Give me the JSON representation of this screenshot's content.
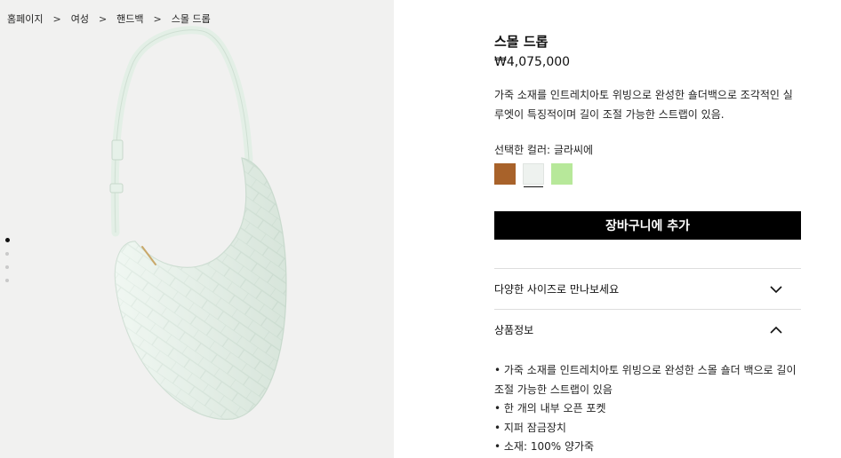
{
  "breadcrumb": {
    "items": [
      "홈페이지",
      "여성",
      "핸드백",
      "스몰 드롭"
    ],
    "separator": ">"
  },
  "gallery": {
    "image_icon": "bag-product-image",
    "dots_count": 4,
    "active_dot": 0
  },
  "product": {
    "title": "스몰 드롭",
    "price": "₩4,075,000",
    "description": "가죽 소재를 인트레치아토 위빙으로 완성한 숄더백으로 조각적인 실루엣이 특징적이며 길이 조절 가능한 스트랩이 있음."
  },
  "color": {
    "label": "선택한 컬러: 글라씨에",
    "swatches": [
      {
        "color": "#a8622a",
        "selected": false
      },
      {
        "color": "#eef2ef",
        "selected": true
      },
      {
        "color": "#b7e89a",
        "selected": false
      }
    ]
  },
  "cart": {
    "button_label": "장바구니에 추가"
  },
  "accordion": {
    "sizes_label": "다양한 사이즈로 만나보세요",
    "sizes_icon": "chevron-down-icon",
    "info_label": "상품정보",
    "info_icon": "chevron-up-icon"
  },
  "info": {
    "bullets": [
      "• 가죽 소재를 인트레치아토 위빙으로 완성한 스몰 숄더 백으로 길이 조절 가능한 스트랩이 있음",
      "• 한 개의 내부 오픈 포켓",
      "• 지퍼 잠금장치",
      "• 소재: 100% 양가죽"
    ]
  },
  "colors": {
    "background_gallery": "#f1f1f0",
    "bag": "#e9f3ec",
    "button": "#000000"
  }
}
